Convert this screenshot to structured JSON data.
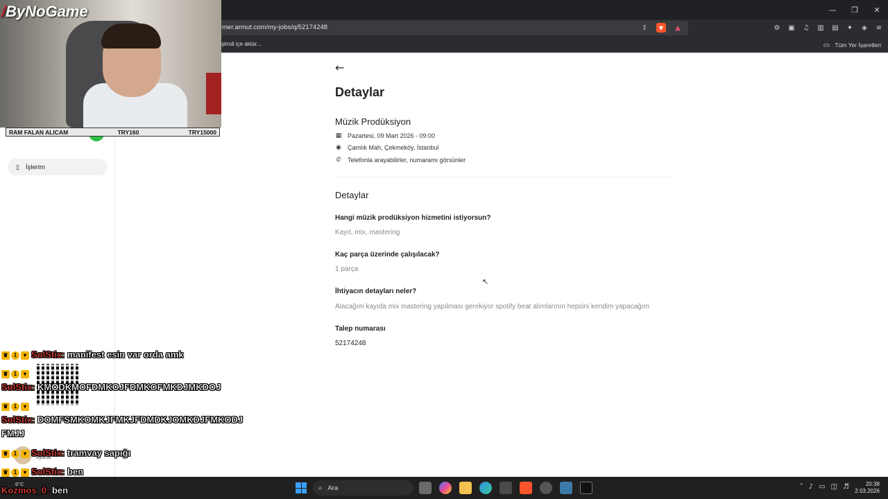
{
  "browser": {
    "url": "mer.armut.com/my-jobs/q/52174248",
    "bookmark_left": "şimdi içe aktar...",
    "bookmark_right": "Tüm Yer İşaretleri",
    "win_minimize": "—",
    "win_restore": "❐",
    "win_close": "✕"
  },
  "sidebar": {
    "active_item": "İşlerim"
  },
  "page": {
    "back": "←",
    "title": "Detaylar",
    "job_title": "Müzik Prodüksiyon",
    "meta": [
      {
        "icon": "calendar-icon",
        "text": "Pazartesi, 09 Mart 2026 - 09:00"
      },
      {
        "icon": "location-icon",
        "text": "Çamlık Mah, Çekmeköy, İstanbul"
      },
      {
        "icon": "phone-icon",
        "text": "Telefonla arayabilirler, numaramı görsünler"
      }
    ],
    "section_title": "Detaylar",
    "qa": [
      {
        "q": "Hangi müzik prodüksiyon hizmetini istiyorsun?",
        "a": "Kayıt, mix, mastering"
      },
      {
        "q": "Kaç parça üzerinde çalışılacak?",
        "a": "1 parça"
      },
      {
        "q": "İhtiyacın detayları neler?",
        "a": "Alacağım kayıda mix mastering yapılması gerekiyor spotify beat alımlarının hepsini kendim yapacağım"
      },
      {
        "q": "Talep numarası",
        "a": "52174248"
      }
    ]
  },
  "overlay": {
    "brand": "ByNoGame",
    "ticker_left": "RAM FALAN ALICAM",
    "ticker_mid": "TRY160",
    "ticker_right": "TRY15000",
    "chat": [
      {
        "user": "SolStix:",
        "msg": "manifest esin var orda amk"
      },
      {
        "user": "SolStix:",
        "msg": "KMODKMOFDMKOJFDMKOFMKDJMKDOJ"
      },
      {
        "user": "SolStix:",
        "msg": "DOMFSMKOMKJFMKJFDMDKJOMKDJFMKODJ"
      },
      {
        "user": "",
        "msg": "FMJJ"
      },
      {
        "user": "SolStix:",
        "msg": "tramvay sapığı"
      },
      {
        "user": "SolStix:",
        "msg": "ben"
      },
      {
        "user": "Kozmos_0:",
        "msg": "ben"
      }
    ],
    "ayarlar": "Ayarlar"
  },
  "taskbar": {
    "weather": "6°C",
    "search_placeholder": "Ara",
    "time": "20:38",
    "date": "2.03.2026"
  }
}
